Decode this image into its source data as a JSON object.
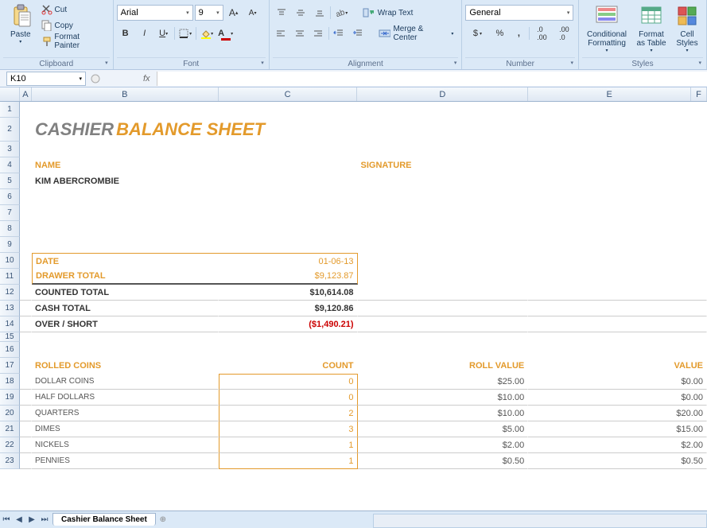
{
  "ribbon": {
    "clipboard": {
      "paste": "Paste",
      "cut": "Cut",
      "copy": "Copy",
      "format_painter": "Format Painter",
      "label": "Clipboard"
    },
    "font": {
      "name": "Arial",
      "size": "9",
      "label": "Font"
    },
    "alignment": {
      "wrap": "Wrap Text",
      "merge": "Merge & Center",
      "label": "Alignment"
    },
    "number": {
      "format": "General",
      "label": "Number"
    },
    "styles": {
      "cond": "Conditional\nFormatting",
      "table": "Format\nas Table",
      "cell": "Cell\nStyles",
      "label": "Styles"
    }
  },
  "formula": {
    "cell_ref": "K10"
  },
  "columns": [
    "A",
    "B",
    "C",
    "D",
    "E",
    "F"
  ],
  "col_widths": {
    "corner": 25,
    "A": 15,
    "B": 235,
    "C": 175,
    "D": 215,
    "E": 225,
    "F": 20
  },
  "sheet": {
    "title1": "CASHIER",
    "title2": "BALANCE SHEET",
    "name_label": "NAME",
    "signature_label": "SIGNATURE",
    "name_value": "KIM ABERCROMBIE",
    "date_label": "DATE",
    "date_value": "01-06-13",
    "drawer_label": "DRAWER TOTAL",
    "drawer_value": "$9,123.87",
    "counted_label": "COUNTED TOTAL",
    "counted_value": "$10,614.08",
    "cash_label": "CASH TOTAL",
    "cash_value": "$9,120.86",
    "over_label": "OVER / SHORT",
    "over_value": "($1,490.21)",
    "rolled_label": "ROLLED COINS",
    "count_label": "COUNT",
    "rollval_label": "ROLL VALUE",
    "value_label": "VALUE",
    "coins": [
      {
        "name": "DOLLAR COINS",
        "count": "0",
        "roll": "$25.00",
        "val": "$0.00"
      },
      {
        "name": "HALF DOLLARS",
        "count": "0",
        "roll": "$10.00",
        "val": "$0.00"
      },
      {
        "name": "QUARTERS",
        "count": "2",
        "roll": "$10.00",
        "val": "$20.00"
      },
      {
        "name": "DIMES",
        "count": "3",
        "roll": "$5.00",
        "val": "$15.00"
      },
      {
        "name": "NICKELS",
        "count": "1",
        "roll": "$2.00",
        "val": "$2.00"
      },
      {
        "name": "PENNIES",
        "count": "1",
        "roll": "$0.50",
        "val": "$0.50"
      }
    ]
  },
  "tab_name": "Cashier Balance Sheet"
}
